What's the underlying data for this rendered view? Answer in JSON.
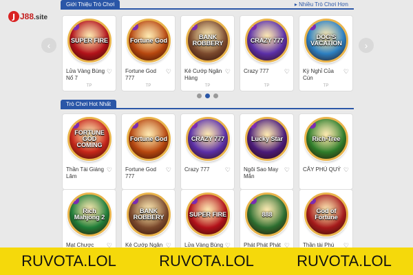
{
  "logo": {
    "mark": "J",
    "text": "J88",
    "domain": ".site"
  },
  "section1": {
    "title": "Giới Thiệu Trò Chơi",
    "more": "Nhiều Trò Chơi Hơn",
    "games": [
      {
        "name": "Lửa Vàng Bùng Nổ 7",
        "art": "SUPER FIRE",
        "color": "#b3121a",
        "provider": "TP"
      },
      {
        "name": "Fortune God 777",
        "art": "Fortune God",
        "color": "#b8480f",
        "provider": "TP"
      },
      {
        "name": "Kẻ Cướp Ngân Hàng",
        "art": "BANK ROBBERY",
        "color": "#7c4a2d",
        "provider": "TP"
      },
      {
        "name": "Crazy 777",
        "art": "CRAZY 777",
        "color": "#5b2fa8",
        "provider": "TP"
      },
      {
        "name": "Kỳ Nghỉ Của Cún",
        "art": "DOG'S VACATION",
        "color": "#2b7fc1",
        "provider": "TP"
      }
    ]
  },
  "carousel": {
    "prev": "‹",
    "next": "›"
  },
  "section2": {
    "title": "Trò Chơi Hot Nhất",
    "games": [
      {
        "name": "Thần Tài Giáng Lâm",
        "art": "FORTUNE GOD COMING",
        "color": "#c8271a"
      },
      {
        "name": "Fortune God 777",
        "art": "Fortune God",
        "color": "#b8480f"
      },
      {
        "name": "Crazy 777",
        "art": "CRAZY 777",
        "color": "#5b2fa8"
      },
      {
        "name": "Ngôi Sao May Mắn",
        "art": "Lucky Star",
        "color": "#4a1b7a"
      },
      {
        "name": "CÂY PHÚ QUÝ",
        "art": "Rich-Tree",
        "color": "#2e7d2a"
      }
    ]
  },
  "section3": {
    "games": [
      {
        "name": "Mạt Chược Phát",
        "art": "Rich Mahjong 2",
        "color": "#1f7e38"
      },
      {
        "name": "Kẻ Cướp Ngân",
        "art": "BANK ROBBERY",
        "color": "#7c4a2d"
      },
      {
        "name": "Lửa Vàng Bùng",
        "art": "SUPER FIRE",
        "color": "#b3121a"
      },
      {
        "name": "Phát Phát Phát",
        "art": "888",
        "color": "#2c6e2f"
      },
      {
        "name": "Thần tài Phú Quý",
        "art": "God of Fortune",
        "color": "#a61b1b"
      }
    ]
  },
  "badge": "Y",
  "heart": "♡",
  "banner": {
    "items": [
      "RUVOTA.LOL",
      "RUVOTA.LOL",
      "RUVOTA.LOL"
    ]
  }
}
